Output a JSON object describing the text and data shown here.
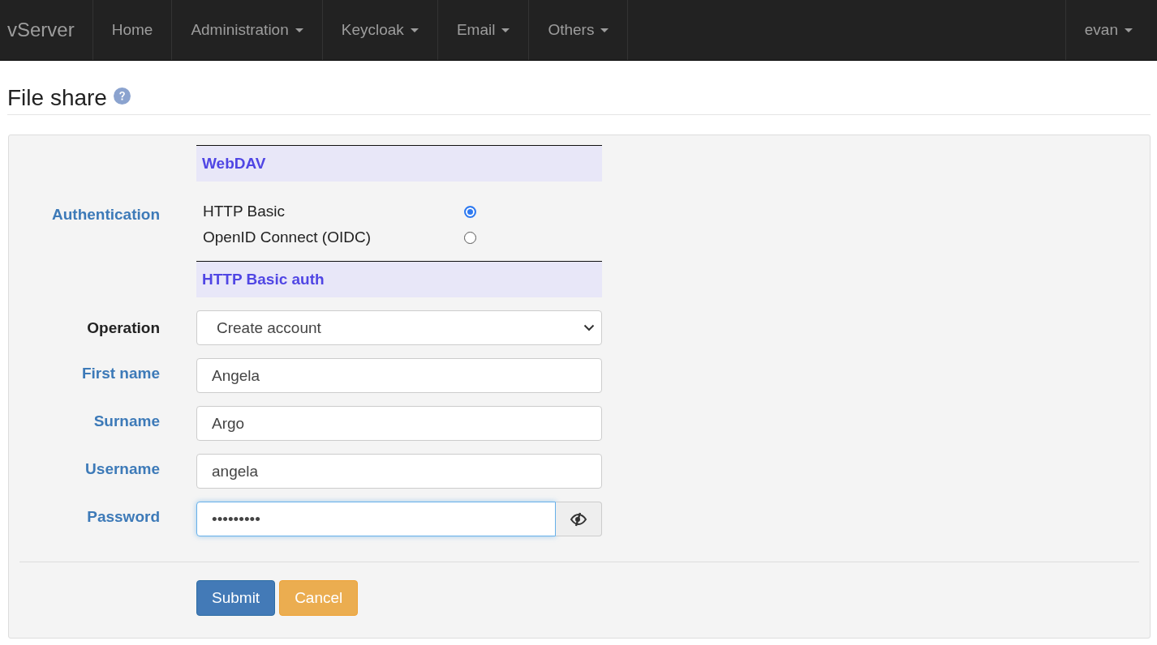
{
  "navbar": {
    "brand": "vServer",
    "items": [
      {
        "label": "Home",
        "dropdown": false
      },
      {
        "label": "Administration",
        "dropdown": true
      },
      {
        "label": "Keycloak",
        "dropdown": true
      },
      {
        "label": "Email",
        "dropdown": true
      },
      {
        "label": "Others",
        "dropdown": true
      }
    ],
    "user": {
      "label": "evan",
      "dropdown": true
    }
  },
  "page": {
    "title": "File share",
    "help": true
  },
  "form": {
    "webdav_header": "WebDAV",
    "authentication": {
      "label": "Authentication",
      "help": true,
      "options": [
        {
          "label": "HTTP Basic",
          "selected": true
        },
        {
          "label": "OpenID Connect (OIDC)",
          "selected": false
        }
      ]
    },
    "basic_header": "HTTP Basic auth",
    "fields": [
      {
        "kind": "select",
        "label": "Operation",
        "help": false,
        "value": "Create account"
      },
      {
        "kind": "text",
        "label": "First name",
        "help": true,
        "value": "Angela"
      },
      {
        "kind": "text",
        "label": "Surname",
        "help": true,
        "value": "Argo"
      },
      {
        "kind": "text",
        "label": "Username",
        "help": true,
        "value": "angela"
      },
      {
        "kind": "password",
        "label": "Password",
        "help": true,
        "value": "•••••••••",
        "focused": true
      }
    ],
    "buttons": [
      {
        "label": "Submit",
        "kind": "primary"
      },
      {
        "label": "Cancel",
        "kind": "warning"
      }
    ]
  }
}
